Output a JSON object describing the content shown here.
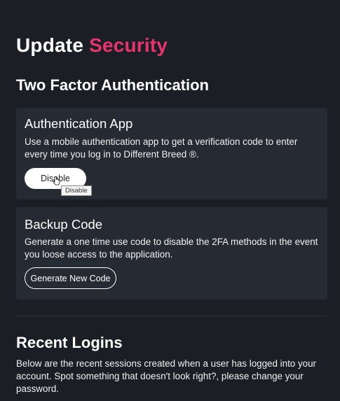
{
  "colors": {
    "background": "#1b1e24",
    "card": "#262a32",
    "accent": "#e8336d"
  },
  "header": {
    "title_prefix": "Update",
    "title_accent": "Security"
  },
  "two_factor": {
    "title": "Two Factor Authentication",
    "auth_app": {
      "title": "Authentication App",
      "description": "Use a mobile authentication app to get a verification code to enter every time you log in to Different Breed ®.",
      "button_label": "Disable",
      "tooltip": "Disable"
    },
    "backup_code": {
      "title": "Backup Code",
      "description": "Generate a one time use code to disable the 2FA methods in the event you loose access to the application.",
      "button_label": "Generate New Code"
    }
  },
  "recent_logins": {
    "title": "Recent Logins",
    "description": "Below are the recent sessions created when a user has logged into your account. Spot something that doesn't look right?, please change your password."
  },
  "cursor": {
    "icon": "hand-pointer-icon"
  }
}
